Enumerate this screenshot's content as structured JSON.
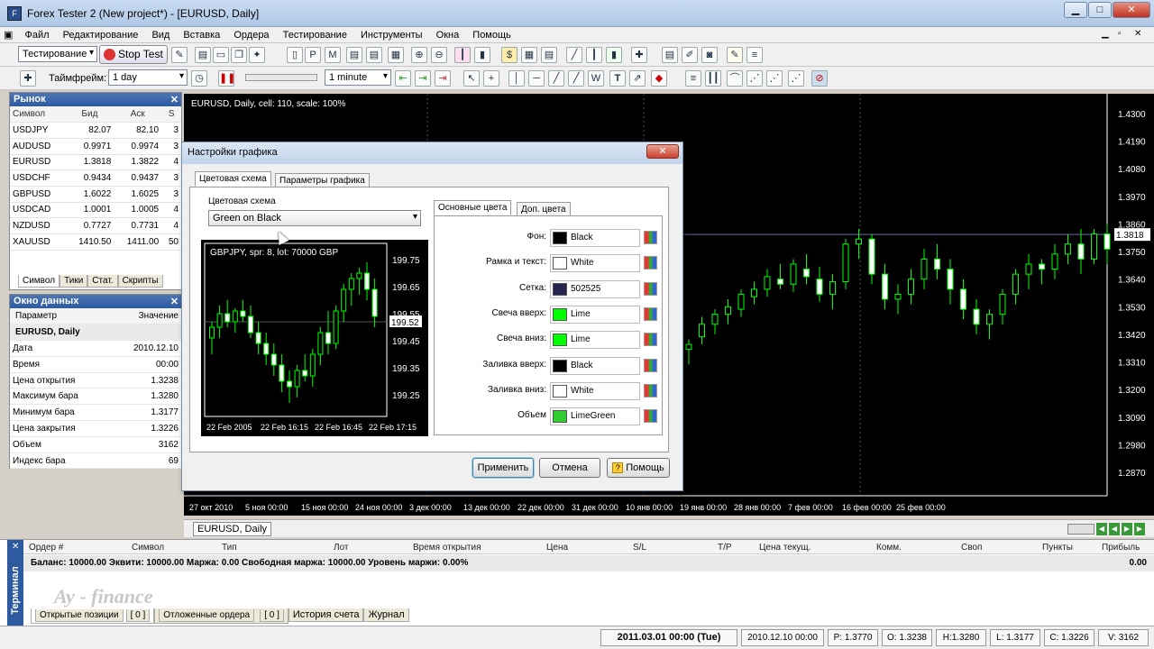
{
  "window": {
    "title": "Forex Tester 2  (New project*) - [EURUSD, Daily]"
  },
  "menu": [
    "Файл",
    "Редактирование",
    "Вид",
    "Вставка",
    "Ордера",
    "Тестирование",
    "Инструменты",
    "Окна",
    "Помощь"
  ],
  "toolbar": {
    "mode_select": "Тестирование",
    "stop_test_label": "Stop Test",
    "timeframe_label": "Таймфрейм:",
    "timeframe_value": "1 day",
    "interval_value": "1 minute"
  },
  "market": {
    "title": "Рынок",
    "headers": [
      "Символ",
      "Бид",
      "Аск",
      "S"
    ],
    "rows": [
      [
        "USDJPY",
        "82.07",
        "82.10",
        "3"
      ],
      [
        "AUDUSD",
        "0.9971",
        "0.9974",
        "3"
      ],
      [
        "EURUSD",
        "1.3818",
        "1.3822",
        "4"
      ],
      [
        "USDCHF",
        "0.9434",
        "0.9437",
        "3"
      ],
      [
        "GBPUSD",
        "1.6022",
        "1.6025",
        "3"
      ],
      [
        "USDCAD",
        "1.0001",
        "1.0005",
        "4"
      ],
      [
        "NZDUSD",
        "0.7727",
        "0.7731",
        "4"
      ],
      [
        "XAUUSD",
        "1410.50",
        "1411.00",
        "50"
      ]
    ],
    "tabs": [
      "Символ",
      "Тики",
      "Стат.",
      "Скрипты"
    ]
  },
  "data_window": {
    "title": "Окно данных",
    "headers": [
      "Параметр",
      "Значение"
    ],
    "group": "EURUSD, Daily",
    "rows": [
      [
        "Дата",
        "2010.12.10"
      ],
      [
        "Время",
        "00:00"
      ],
      [
        "Цена открытия",
        "1.3238"
      ],
      [
        "Максимум бара",
        "1.3280"
      ],
      [
        "Минимум бара",
        "1.3177"
      ],
      [
        "Цена закрытия",
        "1.3226"
      ],
      [
        "Объем",
        "3162"
      ],
      [
        "Индекс бара",
        "69"
      ]
    ]
  },
  "chart": {
    "header": "EURUSD, Daily, cell: 110, scale: 100%",
    "price_labels": [
      "1.4300",
      "1.4190",
      "1.4080",
      "1.3970",
      "1.3860",
      "1.3750",
      "1.3640",
      "1.3530",
      "1.3420",
      "1.3310",
      "1.3200",
      "1.3090",
      "1.2980",
      "1.2870"
    ],
    "current_price": "1.3818",
    "date_labels": [
      "27 окт 2010",
      "5 ноя 00:00",
      "15 ноя 00:00",
      "24 ноя 00:00",
      "3 дек 00:00",
      "13 дек 00:00",
      "22 дек 00:00",
      "31 дек 00:00",
      "10 янв 00:00",
      "19 янв 00:00",
      "28 янв 00:00",
      "7 фев 00:00",
      "16 фев 00:00",
      "25 фев 00:00"
    ],
    "tab": "EURUSD, Daily",
    "colors": {
      "up": "#00ff00",
      "down": "#ffffff",
      "grid": "#505050"
    }
  },
  "dialog": {
    "title": "Настройки графика",
    "tabs": [
      "Цветовая схема",
      "Параметры графика"
    ],
    "scheme_group": "Цветовая схема",
    "scheme_value": "Green on Black",
    "preview": {
      "header": "GBPJPY, spr: 8, lot: 70000 GBP",
      "prices": [
        "199.75",
        "199.65",
        "199.55",
        "199.45",
        "199.35",
        "199.25"
      ],
      "current": "199.52",
      "dates": [
        "22 Feb 2005",
        "22 Feb 16:15",
        "22 Feb 16:45",
        "22 Feb 17:15"
      ]
    },
    "color_tabs": [
      "Основные цвета",
      "Доп. цвета"
    ],
    "colors": [
      {
        "label": "Фон:",
        "name": "Black",
        "hex": "#000000"
      },
      {
        "label": "Рамка и текст:",
        "name": "White",
        "hex": "#ffffff"
      },
      {
        "label": "Сетка:",
        "name": "502525",
        "hex": "#252550"
      },
      {
        "label": "Свеча вверх:",
        "name": "Lime",
        "hex": "#00ff00"
      },
      {
        "label": "Свеча вниз:",
        "name": "Lime",
        "hex": "#00ff00"
      },
      {
        "label": "Заливка вверх:",
        "name": "Black",
        "hex": "#000000"
      },
      {
        "label": "Заливка вниз:",
        "name": "White",
        "hex": "#ffffff"
      },
      {
        "label": "Объем",
        "name": "LimeGreen",
        "hex": "#32cd32"
      }
    ],
    "apply_label": "Применить",
    "cancel_label": "Отмена",
    "help_label": "Помощь"
  },
  "terminal": {
    "side_label": "Терминал",
    "headers": [
      "Ордер #",
      "Символ",
      "Тип",
      "Лот",
      "Время открытия",
      "Цена",
      "S/L",
      "T/P",
      "Цена текущ.",
      "Комм.",
      "Своп",
      "Пункты",
      "Прибыль"
    ],
    "balance_line": "Баланс: 10000.00  Эквити: 10000.00  Маржа: 0.00  Свободная маржа: 10000.00  Уровень маржи: 0.00%",
    "profit": "0.00",
    "watermark": "Ay - finance",
    "tabs": [
      "Открытые позиции",
      "[ 0 ]",
      "Отложенные ордера",
      "[ 0 ]",
      "История счета",
      "Журнал"
    ]
  },
  "status": {
    "time": "2011.03.01 00:00 (Tue)",
    "bar_time": "2010.12.10 00:00",
    "p": "P: 1.3770",
    "o": "O: 1.3238",
    "h": "H:1.3280",
    "l": "L: 1.3177",
    "c": "C: 1.3226",
    "v": "V: 3162"
  }
}
